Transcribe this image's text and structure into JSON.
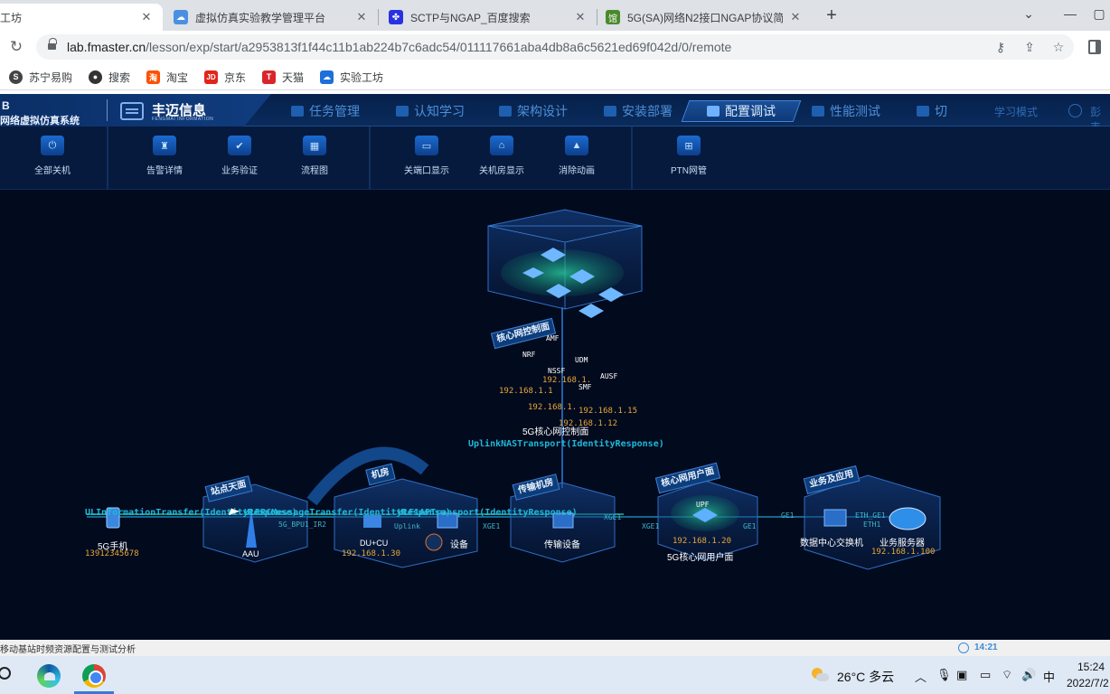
{
  "browser": {
    "tabs": [
      {
        "title": "工坊",
        "favicon": "app-icon",
        "active": true
      },
      {
        "title": "虚拟仿真实验教学管理平台",
        "favicon": "cloud-icon",
        "active": false
      },
      {
        "title": "SCTP与NGAP_百度搜索",
        "favicon": "baidu-paw-icon",
        "active": false
      },
      {
        "title": "5G(SA)网络N2接口NGAP协议简",
        "favicon": "doc-icon",
        "active": false
      }
    ],
    "tab_close": "✕",
    "new_tab": "+",
    "url_host": "lab.fmaster.cn",
    "url_path": "/lesson/exp/start/a2953813f1f44c11b1ab224b7c6adc54/011117661aba4db8a6c5621ed69f042d/0/remote",
    "bookmarks": [
      {
        "label": "苏宁易购",
        "color": "#444444",
        "icon": "S"
      },
      {
        "label": "搜索",
        "color": "#333333",
        "icon": "●"
      },
      {
        "label": "淘宝",
        "color": "#ff5000",
        "icon": "淘"
      },
      {
        "label": "京东",
        "color": "#e1251b",
        "icon": "JD"
      },
      {
        "label": "天猫",
        "color": "#d9262b",
        "icon": "T"
      },
      {
        "label": "实验工坊",
        "color": "#1e6fd9",
        "icon": "☁"
      }
    ]
  },
  "app": {
    "brand_b": "B",
    "brand_system": "网络虚拟仿真系统",
    "brand_name": "丰迈信息",
    "brand_en": "FENGMAI INFORMATION",
    "nav": [
      {
        "label": "任务管理",
        "active": false
      },
      {
        "label": "认知学习",
        "active": false
      },
      {
        "label": "架构设计",
        "active": false
      },
      {
        "label": "安装部署",
        "active": false
      },
      {
        "label": "配置调试",
        "active": true
      },
      {
        "label": "性能测试",
        "active": false
      },
      {
        "label": "切",
        "active": false
      }
    ],
    "mode_label": "学习模式",
    "user_label": "彭韦",
    "toolbar": [
      {
        "label": "全部关机",
        "icon": "power-icon",
        "glyph": "⏻"
      },
      {
        "label": "告警详情",
        "icon": "alarm-icon",
        "glyph": "♜"
      },
      {
        "label": "业务验证",
        "icon": "check-icon",
        "glyph": "✔"
      },
      {
        "label": "流程图",
        "icon": "flowchart-icon",
        "glyph": "▦"
      },
      {
        "label": "关端口显示",
        "icon": "port-icon",
        "glyph": "▭"
      },
      {
        "label": "关机房显示",
        "icon": "room-icon",
        "glyph": "⌂"
      },
      {
        "label": "消除动画",
        "icon": "animation-icon",
        "glyph": "▲"
      },
      {
        "label": "PTN网管",
        "icon": "network-icon",
        "glyph": "⊞"
      }
    ]
  },
  "diagram": {
    "zones": {
      "core_control": "核心网控制面",
      "site": "站点天面",
      "room": "机房",
      "transport": "传输机房",
      "core_user": "核心网用户面",
      "service": "业务及应用"
    },
    "core_nodes": {
      "amf": "AMF",
      "nrf": "NRF",
      "udm": "UDM",
      "nssf": "NSSF",
      "smf": "SMF",
      "ausf": "AUSF",
      "upf": "UPF"
    },
    "ips": {
      "core_a": "192.168.1.1",
      "core_b": "192.168.1.",
      "core_c": "192.168.1.15",
      "core_d": "192.168.1.12",
      "core_e": "192.168.1.",
      "phone": "13912345678",
      "du": "192.168.1.30",
      "upf": "192.168.1.20",
      "server": "192.168.1.100"
    },
    "labels": {
      "core_control": "5G核心网控制面",
      "phone": "5G手机",
      "aau": "AAU",
      "du": "DU+CU",
      "device": "设备",
      "transport": "传输设备",
      "core_user": "5G核心网用户面",
      "dc_switch": "数据中心交换机",
      "server": "业务服务器"
    },
    "ports": {
      "bpu": "5G_BPU1_IR2",
      "uplink": "Uplink",
      "xge1_a": "XGE1",
      "xge1_b": "XGE1",
      "xge1_c": "XGE1",
      "ge1_a": "GE1",
      "ge1_b": "GE1",
      "eth_ge1": "ETH_GE1",
      "eth1": "ETH1"
    },
    "messages": {
      "nas": "UplinkNASTransport(IdentityResponse)",
      "ul_info": "ULInformationTransfer(IdentityResponse)",
      "ul_rrc": "ULRRCMessageTransfer(IdentityResponse)",
      "ul_f1": "ULF1APTransport(IdentityResponse)"
    }
  },
  "statusbar": {
    "text": "移动基站时频资源配置与测试分析",
    "time": "14:21"
  },
  "taskbar": {
    "temperature": "26°C  多云",
    "ime": "中",
    "time": "15:24",
    "date": "2022/7/2"
  },
  "colors": {
    "app_bg": "#020a1e",
    "accent": "#3f86de",
    "ip_text": "#e8a838",
    "message_text": "#1fb8d8"
  }
}
